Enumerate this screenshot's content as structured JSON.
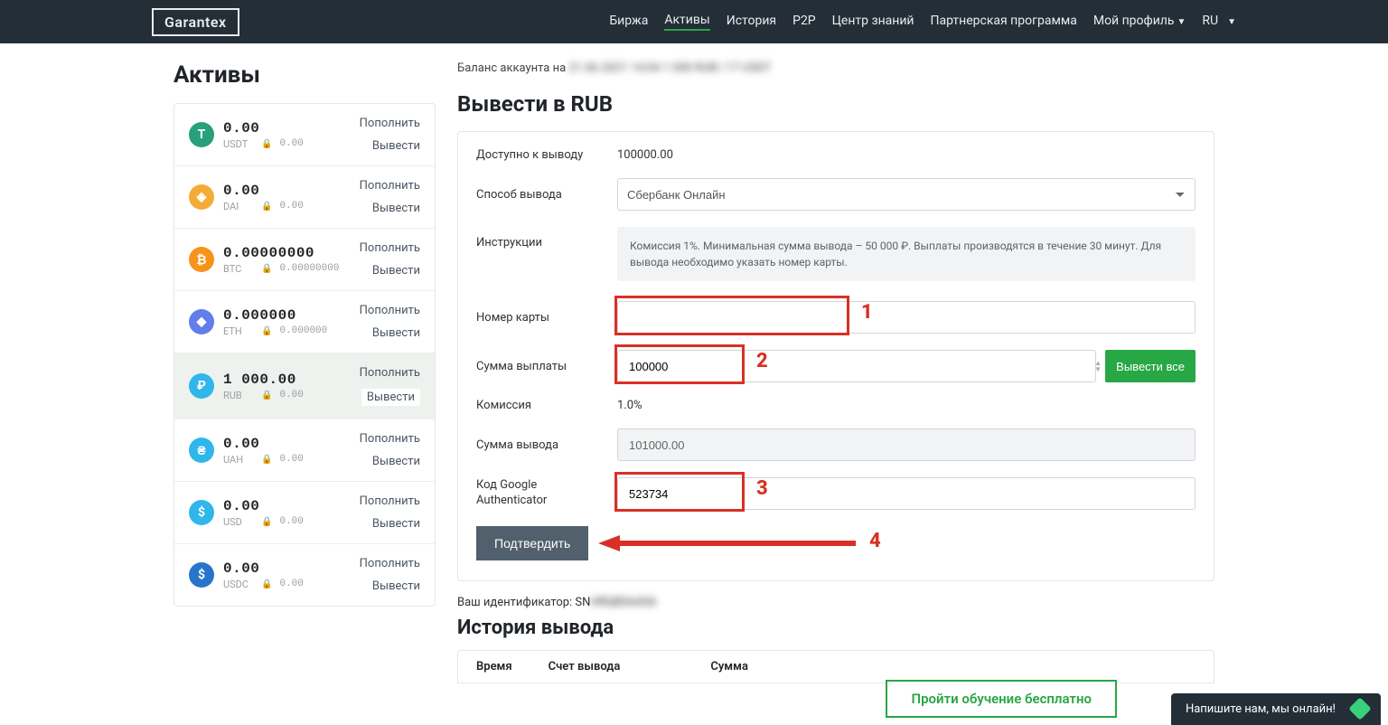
{
  "nav": {
    "logo": "Garantex",
    "links": {
      "exchange": "Биржа",
      "assets": "Активы",
      "history": "История",
      "p2p": "P2P",
      "knowledge": "Центр знаний",
      "affiliate": "Партнерская программа",
      "profile": "Мой профиль",
      "lang": "RU"
    }
  },
  "page_title": "Активы",
  "balance_prefix": "Баланс аккаунта на ",
  "balance_hidden": "21.06.2021 14:04 1 000 RUB | 17 USDT",
  "assets": [
    {
      "sym": "USDT",
      "amount": "0.00",
      "locked": "0.00",
      "color": "#26a17b",
      "glyph": "T"
    },
    {
      "sym": "DAI",
      "amount": "0.00",
      "locked": "0.00",
      "color": "#f5ac37",
      "glyph": "◈"
    },
    {
      "sym": "BTC",
      "amount": "0.00000000",
      "locked": "0.00000000",
      "color": "#f7931a",
      "glyph": "₿"
    },
    {
      "sym": "ETH",
      "amount": "0.000000",
      "locked": "0.000000",
      "color": "#627eea",
      "glyph": "◆"
    },
    {
      "sym": "RUB",
      "amount": "1 000.00",
      "locked": "0.00",
      "color": "#2fb6ea",
      "glyph": "₽",
      "active": true
    },
    {
      "sym": "UAH",
      "amount": "0.00",
      "locked": "0.00",
      "color": "#2fb6ea",
      "glyph": "₴"
    },
    {
      "sym": "USD",
      "amount": "0.00",
      "locked": "0.00",
      "color": "#2fb6ea",
      "glyph": "$"
    },
    {
      "sym": "USDC",
      "amount": "0.00",
      "locked": "0.00",
      "color": "#2775ca",
      "glyph": "$"
    }
  ],
  "asset_actions": {
    "deposit": "Пополнить",
    "withdraw": "Вывести"
  },
  "withdraw": {
    "heading": "Вывести в RUB",
    "labels": {
      "available": "Доступно к выводу",
      "method": "Способ вывода",
      "instructions": "Инструкции",
      "card": "Номер карты",
      "amount": "Сумма выплаты",
      "fee": "Комиссия",
      "total": "Сумма вывода",
      "ga": "Код Google Authenticator"
    },
    "available": "100000.00",
    "method_selected": "Сбербанк Онлайн",
    "instructions_text": "Комиссия 1%. Минимальная сумма вывода – 50 000 ₽. Выплаты производятся в течение 30 минут. Для вывода необходимо указать номер карты.",
    "amount_value": "100000",
    "fee": "1.0%",
    "total": "101000.00",
    "ga_value": "523734",
    "withdraw_all": "Вывести все",
    "confirm": "Подтвердить"
  },
  "steps": {
    "s1": "1",
    "s2": "2",
    "s3": "3",
    "s4": "4"
  },
  "identifier": {
    "label": "Ваш идентификатор: ",
    "prefix": "SN",
    "hidden": "HRQB5A45A"
  },
  "history": {
    "title": "История вывода",
    "cols": {
      "time": "Время",
      "account": "Счет вывода",
      "sum": "Сумма"
    }
  },
  "promo": "Пройти обучение бесплатно",
  "chat": "Напишите нам, мы онлайн!"
}
